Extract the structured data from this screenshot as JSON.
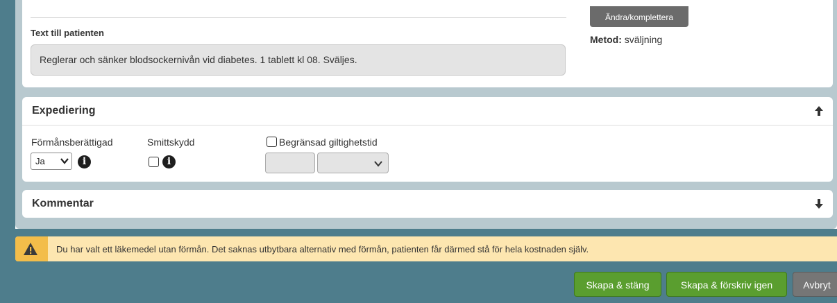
{
  "prescription": {
    "patient_text_label": "Text till patienten",
    "patient_text_value": "Reglerar och sänker blodsockernivån vid diabetes. 1 tablett kl 08. Sväljes.",
    "amend_button": "Ändra/komplettera",
    "method_label": "Metod:",
    "method_value": "sväljning"
  },
  "expediering": {
    "title": "Expediering",
    "formans_label": "Förmånsberättigad",
    "formans_value": "Ja",
    "smittskydd_label": "Smittskydd",
    "smittskydd_checked": false,
    "begransad_label": "Begränsad giltighetstid",
    "begransad_checked": false,
    "expanded": true
  },
  "kommentar": {
    "title": "Kommentar",
    "expanded": false
  },
  "warning": {
    "text": "Du har valt ett läkemedel utan förmån. Det saknas utbytbara alternativ med förmån, patienten får därmed stå för hela kostnaden själv."
  },
  "footer": {
    "create_close": "Skapa & stäng",
    "create_again": "Skapa & förskriv igen",
    "cancel": "Avbryt"
  },
  "icons": {
    "info": "info-icon",
    "warning": "warning-triangle-icon",
    "collapse": "arrow-up-icon",
    "expand": "arrow-down-icon"
  },
  "colors": {
    "teal": "#4e7d8c",
    "green_button": "#5a9e2f",
    "warning_bg": "#fde6b0",
    "warning_icon_bg": "#f3bd4a"
  }
}
